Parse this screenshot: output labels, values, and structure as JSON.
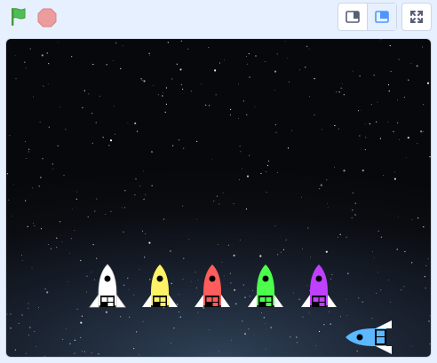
{
  "toolbar": {
    "green_flag": {
      "icon": "green-flag-icon",
      "color": "#4cbf56"
    },
    "stop": {
      "icon": "stop-sign-icon",
      "color": "#ec9c9c"
    },
    "small_stage": {
      "icon": "small-stage-icon",
      "active": false
    },
    "normal_stage": {
      "icon": "normal-stage-icon",
      "active": true
    },
    "fullscreen": {
      "icon": "fullscreen-icon"
    }
  },
  "stage": {
    "backdrop": "space-stars",
    "sprites": [
      {
        "name": "rocket-white",
        "color": "#ffffff"
      },
      {
        "name": "rocket-yellow",
        "color": "#fff266"
      },
      {
        "name": "rocket-red",
        "color": "#ff5c5c"
      },
      {
        "name": "rocket-green",
        "color": "#4dff4d"
      },
      {
        "name": "rocket-purple",
        "color": "#c040ff"
      },
      {
        "name": "player-ship",
        "color": "#5cb8ff"
      }
    ]
  }
}
